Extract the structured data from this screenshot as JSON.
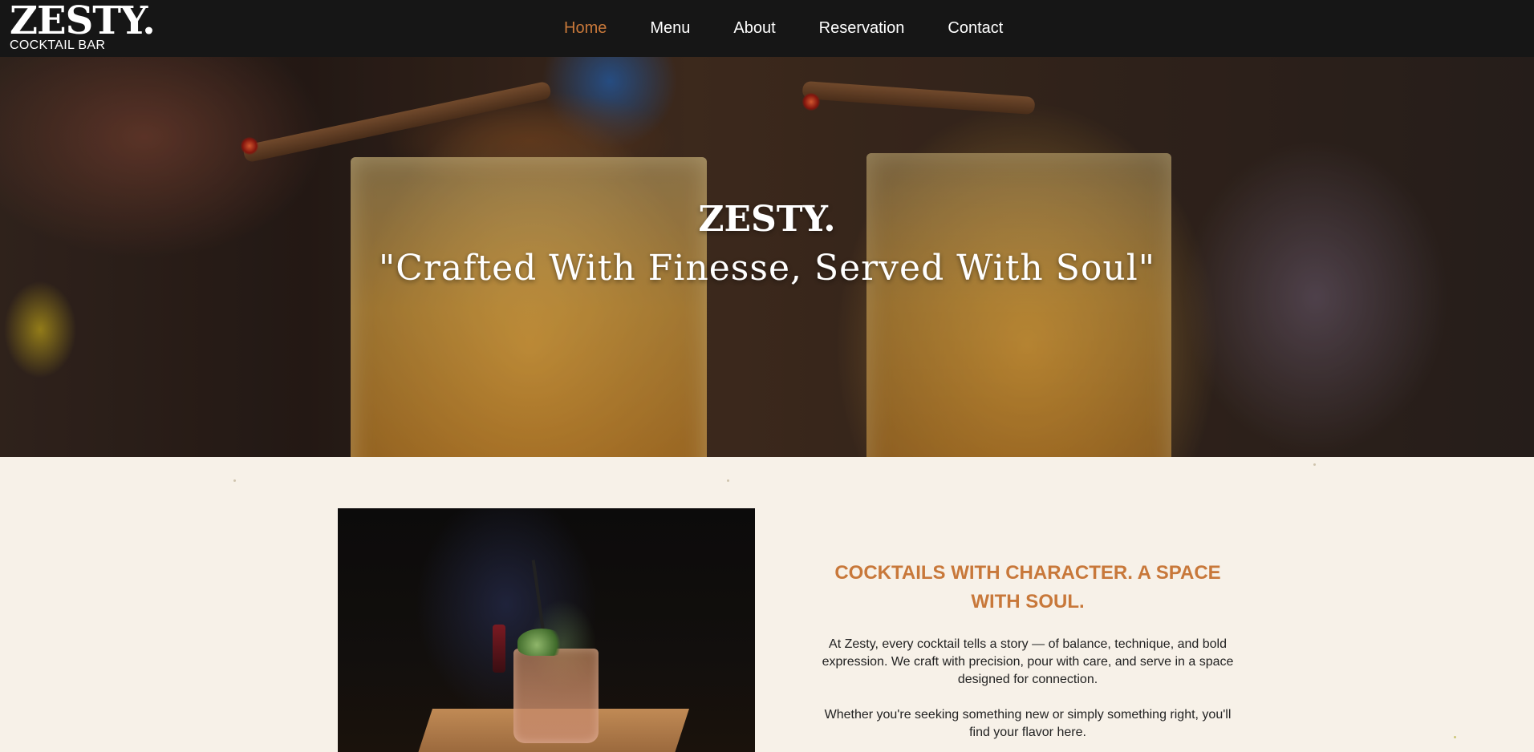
{
  "brand": {
    "title": "ZESTY.",
    "subtitle": "COCKTAIL BAR"
  },
  "nav": {
    "items": [
      {
        "label": "Home",
        "active": true
      },
      {
        "label": "Menu",
        "active": false
      },
      {
        "label": "About",
        "active": false
      },
      {
        "label": "Reservation",
        "active": false
      },
      {
        "label": "Contact",
        "active": false
      }
    ]
  },
  "hero": {
    "title": "ZESTY.",
    "tagline": "\"Crafted With Finesse, Served With Soul\""
  },
  "about": {
    "heading": "COCKTAILS WITH CHARACTER. A SPACE WITH SOUL.",
    "paragraph1": "At Zesty, every cocktail tells a story — of balance, technique, and bold expression. We craft with precision, pour with care, and serve in a space designed for connection.",
    "paragraph2": "Whether you're seeking something new or simply something right, you'll find your flavor here."
  },
  "colors": {
    "accent": "#c8783a",
    "header_bg": "#161616",
    "page_bg": "#f7f1e8"
  }
}
